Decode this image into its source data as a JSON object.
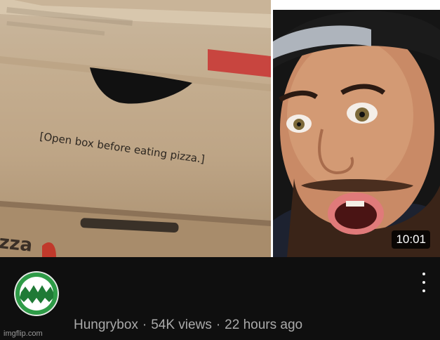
{
  "thumbnail": {
    "box_caption": "[Open box before eating pizza.]",
    "box_bottom_text": "zza",
    "duration": "10:01"
  },
  "video_meta": {
    "channel": "Hungrybox",
    "separator": "·",
    "views": "54K views",
    "age": "22 hours ago"
  },
  "icons": {
    "avatar": "channel-avatar-icon",
    "menu": "more-vert-icon"
  },
  "colors": {
    "background": "#0f0f0f",
    "meta_text": "#aaaaaa",
    "avatar_green": "#2e9b47",
    "duration_badge": "#000000"
  },
  "watermark": "imgflip.com"
}
